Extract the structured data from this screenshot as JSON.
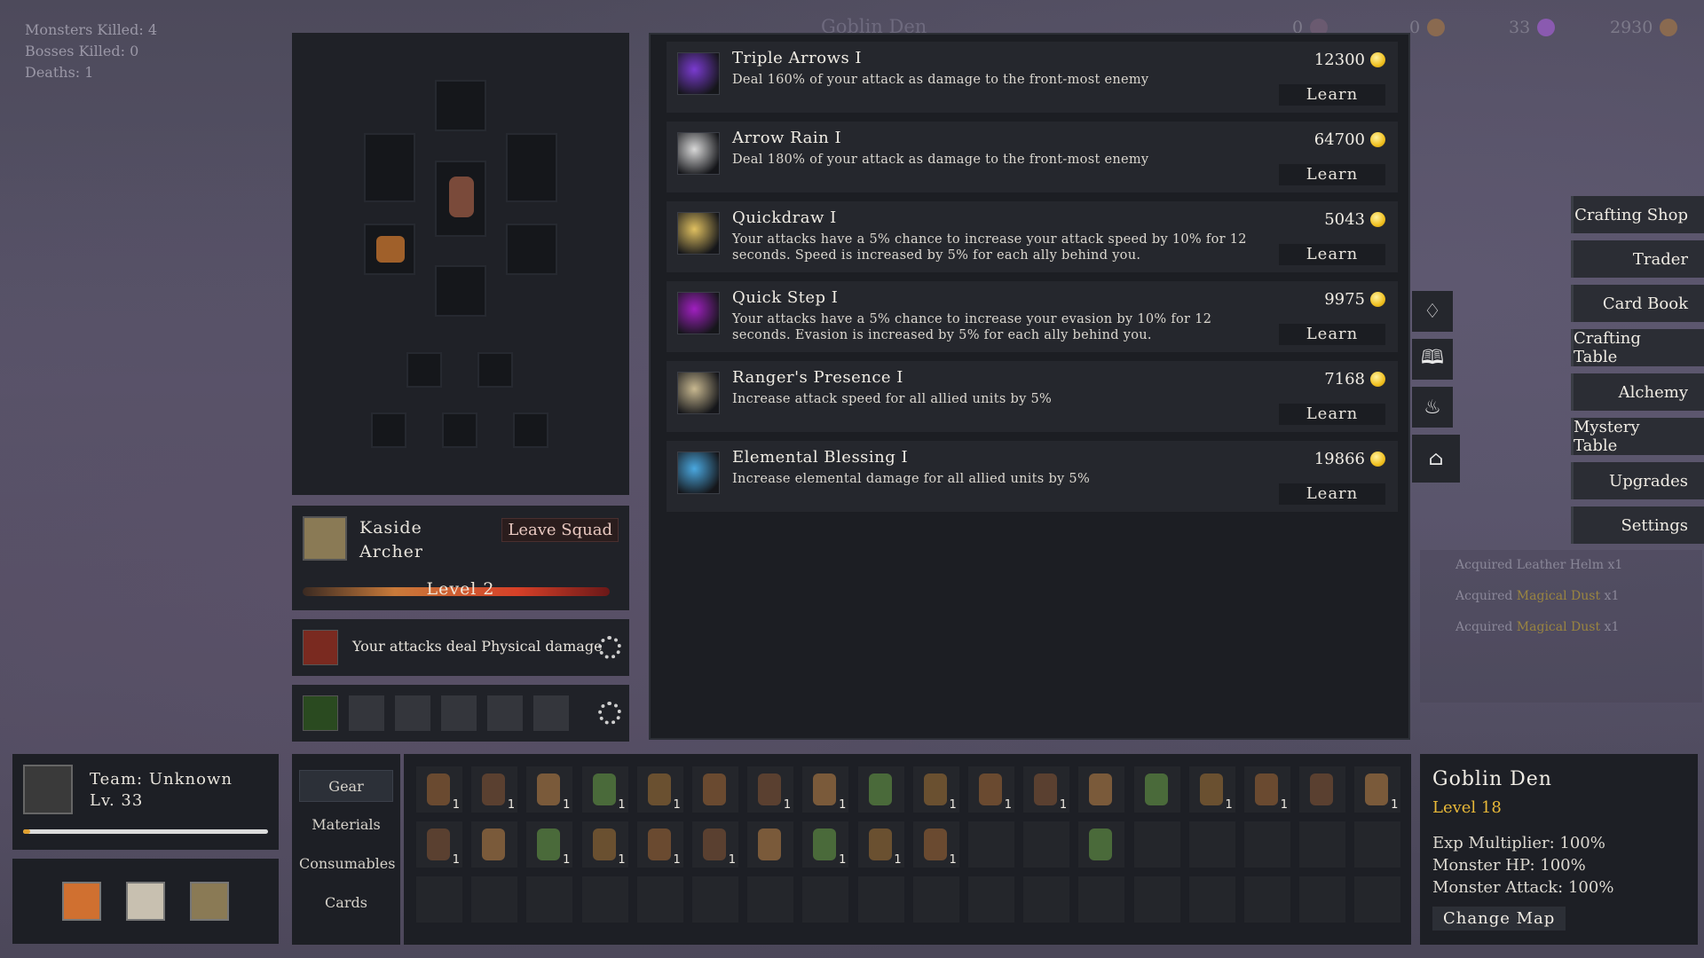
{
  "stats": {
    "monsters_killed": "Monsters Killed: 4",
    "bosses_killed": "Bosses Killed: 0",
    "deaths": "Deaths: 1"
  },
  "topbar": {
    "map_title": "Goblin Den",
    "res1": "0",
    "res2": "0",
    "res3": "33",
    "res4": "2930"
  },
  "hero": {
    "name": "Kaside",
    "class": "Archer",
    "leave_label": "Leave Squad",
    "level": "Level 2",
    "damage_text": "Your attacks deal Physical damage"
  },
  "skills": [
    {
      "name": "Triple Arrows I",
      "desc": "Deal 160% of your attack as damage to the front-most enemy",
      "price": "12300",
      "learn": "Learn",
      "color": "#7a3bd0"
    },
    {
      "name": "Arrow Rain I",
      "desc": "Deal 180% of your attack as damage to the front-most enemy",
      "price": "64700",
      "learn": "Learn",
      "color": "#d8d8d8"
    },
    {
      "name": "Quickdraw I",
      "desc": "Your attacks have a 5% chance to increase your attack speed by 10% for 12 seconds. Speed is increased by 5% for each ally behind you.",
      "price": "5043",
      "learn": "Learn",
      "color": "#e0c060"
    },
    {
      "name": "Quick Step I",
      "desc": "Your attacks have a 5% chance to increase your evasion by 10% for 12 seconds. Evasion is increased by 5% for each ally behind you.",
      "price": "9975",
      "learn": "Learn",
      "color": "#a020c0"
    },
    {
      "name": "Ranger's Presence I",
      "desc": "Increase attack speed for all allied units by 5%",
      "price": "7168",
      "learn": "Learn",
      "color": "#c8b890"
    },
    {
      "name": "Elemental Blessing I",
      "desc": "Increase elemental damage for all allied units by 5%",
      "price": "19866",
      "learn": "Learn",
      "color": "#4aa8e0"
    }
  ],
  "menu": [
    "Crafting Shop",
    "Trader",
    "Card Book",
    "Crafting Table",
    "Alchemy",
    "Mystery Table",
    "Upgrades",
    "Settings"
  ],
  "side_icons": [
    "cards-icon",
    "book-icon",
    "fire-icon",
    "shop-icon"
  ],
  "log": {
    "line1": "Acquired Leather Helm x1",
    "line2_a": "Acquired ",
    "line2_b": "Magical Dust",
    "line2_c": " x1",
    "line3_a": "Acquired ",
    "line3_b": "Magical Dust",
    "line3_c": " x1"
  },
  "team": {
    "name": "Team: Unknown",
    "level": "Lv. 33",
    "xp_fraction": 0.03
  },
  "tabs": [
    "Gear",
    "Materials",
    "Consumables",
    "Cards"
  ],
  "inventory": {
    "row1": [
      "1",
      "1",
      "1",
      "1",
      "1",
      "",
      "1",
      "1",
      "",
      "1",
      "1",
      "1",
      "",
      "",
      "1",
      "1",
      "",
      "1"
    ],
    "row2": [
      "1",
      "",
      "1",
      "1",
      "1",
      "1",
      "",
      "1",
      "1",
      "1",
      "",
      "",
      "",
      "",
      "",
      "",
      "",
      ""
    ]
  },
  "map": {
    "title": "Goblin Den",
    "level": "Level 18",
    "exp": "Exp Multiplier: 100%",
    "hp": "Monster HP: 100%",
    "attack": "Monster Attack: 100%",
    "change": "Change Map"
  }
}
